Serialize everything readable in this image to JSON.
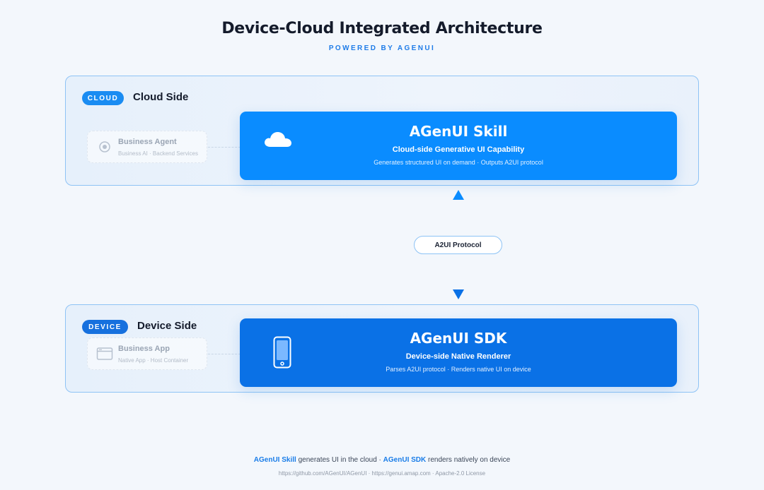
{
  "title": "Device-Cloud Integrated Architecture",
  "subtitle": "POWERED BY AGENUI",
  "colors": {
    "accent": "#1a8cf2",
    "skill_card": "#0a8cff",
    "sdk_card": "#0a71e6",
    "panel_border": "#8ec3f5",
    "background": "#f3f7fc"
  },
  "cloud": {
    "badge": "CLOUD",
    "title": "Cloud Side",
    "agent": {
      "icon": "target-icon",
      "title": "Business Agent",
      "desc": "Business AI · Backend Services"
    },
    "skill": {
      "icon": "cloud-icon",
      "title": "AGenUI Skill",
      "subtitle": "Cloud-side Generative UI Capability",
      "desc": "Generates structured UI on demand · Outputs A2UI protocol"
    }
  },
  "protocol": {
    "label": "A2UI Protocol",
    "arrow_up_icon": "arrow-up-icon",
    "arrow_down_icon": "arrow-down-icon"
  },
  "device": {
    "badge": "DEVICE",
    "title": "Device Side",
    "app": {
      "icon": "browser-window-icon",
      "title": "Business App",
      "desc": "Native App · Host Container"
    },
    "sdk": {
      "icon": "phone-icon",
      "title": "AGenUI SDK",
      "subtitle": "Device-side Native Renderer",
      "desc": "Parses A2UI protocol · Renders native UI on device"
    }
  },
  "footer": {
    "skill_label": "AGenUI Skill",
    "skill_text": "generates UI in the cloud",
    "separator": "·",
    "sdk_label": "AGenUI SDK",
    "sdk_text": "renders natively on device",
    "links": "https://github.com/AGenUI/AGenUI · https://genui.amap.com · Apache-2.0 License"
  }
}
